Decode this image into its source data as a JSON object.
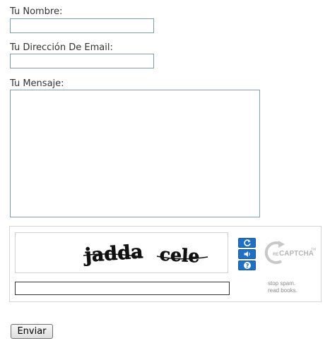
{
  "form": {
    "name_label": "Tu Nombre:",
    "name_value": "",
    "email_label": "Tu Dirección De Email:",
    "email_value": "",
    "message_label": "Tu Mensaje:",
    "message_value": "",
    "submit_label": "Enviar"
  },
  "captcha": {
    "challenge_word_1": "jadda",
    "challenge_word_2": "cele",
    "response_value": "",
    "logo_prefix": "RE",
    "logo_text": "CAPTCHA",
    "logo_tm": "TM",
    "tagline_line1": "stop spam.",
    "tagline_line2": "read books.",
    "icons": [
      "refresh-icon",
      "audio-icon",
      "help-icon"
    ],
    "button_color": "#1f6fc5"
  }
}
